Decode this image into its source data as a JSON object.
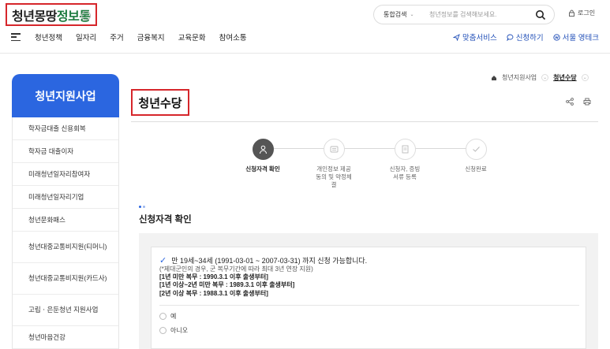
{
  "header": {
    "logo": {
      "part1": "청년몽땅",
      "part2": "정보통"
    },
    "search": {
      "category": "통합검색",
      "placeholder": "청년정보를 검색해보세요."
    },
    "login_label": "로그인"
  },
  "nav": {
    "items": [
      "청년정책",
      "일자리",
      "주거",
      "금융복지",
      "교육문화",
      "참여소통"
    ],
    "right": [
      "맞춤서비스",
      "신청하기",
      "서울 영테크"
    ]
  },
  "sidebar": {
    "title": "청년지원사업",
    "items": [
      "학자금대출 신용회복",
      "학자금 대출이자",
      "미래청년일자리참여자",
      "미래청년일자리기업",
      "청년문화패스",
      "청년대중교통비지원(티머니)",
      "청년대중교통비지원(카드사)",
      "고립ㆍ은둔청년 지원사업",
      "청년마음건강"
    ]
  },
  "breadcrumb": {
    "level1": "청년지원사업",
    "current": "청년수당"
  },
  "page_title": "청년수당",
  "steps": [
    {
      "label": "신청자격 확인",
      "active": true
    },
    {
      "label": "개인정보 제공동의 및 약정체결",
      "active": false
    },
    {
      "label": "신청자, 증빙서류 등록",
      "active": false
    },
    {
      "label": "신청완료",
      "active": false
    }
  ],
  "section": {
    "title": "신청자격 확인",
    "requirement": "만 19세~34세 (1991-03-01 ~ 2007-03-31) 까지 신청 가능합니다.",
    "note": "(*제대군인의 경우, 군 복무기간에 따라 최대 3년 연장 지원)",
    "rules": [
      "[1년 미만 복무 : 1990.3.1 이후 출생부터]",
      "[1년 이상~2년 미만 복무 : 1989.3.1 이후 출생부터]",
      "[2년 이상 복무 : 1988.3.1 이후 출생부터]"
    ],
    "options": [
      "예",
      "아니오"
    ]
  },
  "colors": {
    "accent": "#2b66e0",
    "highlight_box": "#d6262b",
    "logo_green": "#1b7a3d"
  }
}
